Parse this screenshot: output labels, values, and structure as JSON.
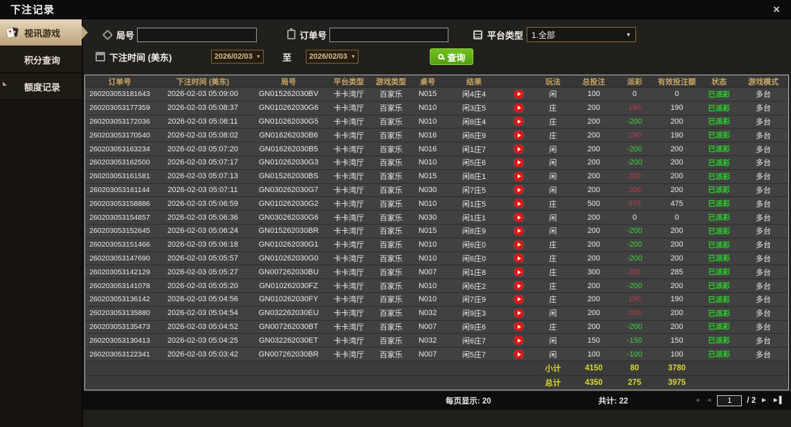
{
  "window": {
    "title": "下注记录",
    "close": "×"
  },
  "sidebar": {
    "items": [
      {
        "label": "视讯游戏",
        "icon": "cards-icon",
        "active": true
      },
      {
        "label": "积分查询",
        "icon": "gem-icon",
        "active": false
      },
      {
        "label": "额度记录",
        "icon": "document-icon",
        "active": false
      }
    ]
  },
  "search": {
    "round_label": "局号",
    "round_value": "",
    "order_label": "订单号",
    "order_value": "",
    "platform_label": "平台类型",
    "platform_value": "1.全部",
    "time_label": "下注时间 (美东)",
    "date_from": "2026/02/03",
    "to_label": "至",
    "date_to": "2026/02/03",
    "query_label": "查询"
  },
  "table": {
    "headers": [
      "订单号",
      "下注时间 (美东)",
      "局号",
      "平台类型",
      "游戏类型",
      "桌号",
      "结果",
      "",
      "玩法",
      "总投注",
      "派彩",
      "有效投注额",
      "状态",
      "游戏模式"
    ],
    "rows": [
      [
        "260203053181643",
        "2026-02-03 05:09:00",
        "GN015262030BV",
        "卡卡湾厅",
        "百家乐",
        "N015",
        "闲4庄4",
        "闲",
        "100",
        "0",
        "0",
        "已派彩",
        "多台"
      ],
      [
        "260203053177359",
        "2026-02-03 05:08:37",
        "GN010262030G6",
        "卡卡湾厅",
        "百家乐",
        "N010",
        "闲3庄5",
        "庄",
        "200",
        "190",
        "190",
        "已派彩",
        "多台"
      ],
      [
        "260203053172036",
        "2026-02-03 05:08:11",
        "GN010262030G5",
        "卡卡湾厅",
        "百家乐",
        "N010",
        "闲8庄4",
        "庄",
        "200",
        "-200",
        "200",
        "已派彩",
        "多台"
      ],
      [
        "260203053170540",
        "2026-02-03 05:08:02",
        "GN016262030B6",
        "卡卡湾厅",
        "百家乐",
        "N016",
        "闲6庄9",
        "庄",
        "200",
        "190",
        "190",
        "已派彩",
        "多台"
      ],
      [
        "260203053163234",
        "2026-02-03 05:07:20",
        "GN016262030B5",
        "卡卡湾厅",
        "百家乐",
        "N016",
        "闲1庄7",
        "闲",
        "200",
        "-200",
        "200",
        "已派彩",
        "多台"
      ],
      [
        "260203053162500",
        "2026-02-03 05:07:17",
        "GN010262030G3",
        "卡卡湾厅",
        "百家乐",
        "N010",
        "闲5庄6",
        "闲",
        "200",
        "-200",
        "200",
        "已派彩",
        "多台"
      ],
      [
        "260203053161581",
        "2026-02-03 05:07:13",
        "GN015262030BS",
        "卡卡湾厅",
        "百家乐",
        "N015",
        "闲8庄1",
        "闲",
        "200",
        "200",
        "200",
        "已派彩",
        "多台"
      ],
      [
        "260203053161144",
        "2026-02-03 05:07:11",
        "GN030262030G7",
        "卡卡湾厅",
        "百家乐",
        "N030",
        "闲7庄5",
        "闲",
        "200",
        "200",
        "200",
        "已派彩",
        "多台"
      ],
      [
        "260203053158886",
        "2026-02-03 05:06:59",
        "GN010262030G2",
        "卡卡湾厅",
        "百家乐",
        "N010",
        "闲1庄5",
        "庄",
        "500",
        "475",
        "475",
        "已派彩",
        "多台"
      ],
      [
        "260203053154857",
        "2026-02-03 05:06:36",
        "GN030262030G6",
        "卡卡湾厅",
        "百家乐",
        "N030",
        "闲1庄1",
        "闲",
        "200",
        "0",
        "0",
        "已派彩",
        "多台"
      ],
      [
        "260203053152645",
        "2026-02-03 05:06:24",
        "GN015262030BR",
        "卡卡湾厅",
        "百家乐",
        "N015",
        "闲8庄9",
        "闲",
        "200",
        "-200",
        "200",
        "已派彩",
        "多台"
      ],
      [
        "260203053151466",
        "2026-02-03 05:06:18",
        "GN010262030G1",
        "卡卡湾厅",
        "百家乐",
        "N010",
        "闲6庄0",
        "庄",
        "200",
        "-200",
        "200",
        "已派彩",
        "多台"
      ],
      [
        "260203053147690",
        "2026-02-03 05:05:57",
        "GN010262030G0",
        "卡卡湾厅",
        "百家乐",
        "N010",
        "闲6庄0",
        "庄",
        "200",
        "-200",
        "200",
        "已派彩",
        "多台"
      ],
      [
        "260203053142129",
        "2026-02-03 05:05:27",
        "GN007262030BU",
        "卡卡湾厅",
        "百家乐",
        "N007",
        "闲1庄8",
        "庄",
        "300",
        "285",
        "285",
        "已派彩",
        "多台"
      ],
      [
        "260203053141078",
        "2026-02-03 05:05:20",
        "GN010262030FZ",
        "卡卡湾厅",
        "百家乐",
        "N010",
        "闲6庄2",
        "庄",
        "200",
        "-200",
        "200",
        "已派彩",
        "多台"
      ],
      [
        "260203053136142",
        "2026-02-03 05:04:56",
        "GN010262030FY",
        "卡卡湾厅",
        "百家乐",
        "N010",
        "闲7庄9",
        "庄",
        "200",
        "190",
        "190",
        "已派彩",
        "多台"
      ],
      [
        "260203053135880",
        "2026-02-03 05:04:54",
        "GN032262030EU",
        "卡卡湾厅",
        "百家乐",
        "N032",
        "闲9庄3",
        "闲",
        "200",
        "200",
        "200",
        "已派彩",
        "多台"
      ],
      [
        "260203053135473",
        "2026-02-03 05:04:52",
        "GN007262030BT",
        "卡卡湾厅",
        "百家乐",
        "N007",
        "闲9庄6",
        "庄",
        "200",
        "-200",
        "200",
        "已派彩",
        "多台"
      ],
      [
        "260203053130413",
        "2026-02-03 05:04:25",
        "GN032262030ET",
        "卡卡湾厅",
        "百家乐",
        "N032",
        "闲6庄7",
        "闲",
        "150",
        "-150",
        "150",
        "已派彩",
        "多台"
      ],
      [
        "260203053122341",
        "2026-02-03 05:03:42",
        "GN007262030BR",
        "卡卡湾厅",
        "百家乐",
        "N007",
        "闲5庄7",
        "闲",
        "100",
        "-100",
        "100",
        "已派彩",
        "多台"
      ]
    ],
    "summary": {
      "subtotal_label": "小计",
      "subtotal": [
        "4150",
        "80",
        "3780"
      ],
      "total_label": "总计",
      "total": [
        "4350",
        "275",
        "3975"
      ]
    }
  },
  "footer": {
    "per_page_label": "每页显示: 20",
    "total_count_label": "共计: 22",
    "page": "1",
    "pages_suffix": "/ 2"
  },
  "colors": {
    "accent_gold": "#c9a563",
    "active_tab": "#bda179",
    "win_red": "#c0394a",
    "lose_green": "#42d442",
    "status_green": "#2bd22b",
    "summary_yellow": "#d8d832",
    "query_green": "#62b616"
  }
}
